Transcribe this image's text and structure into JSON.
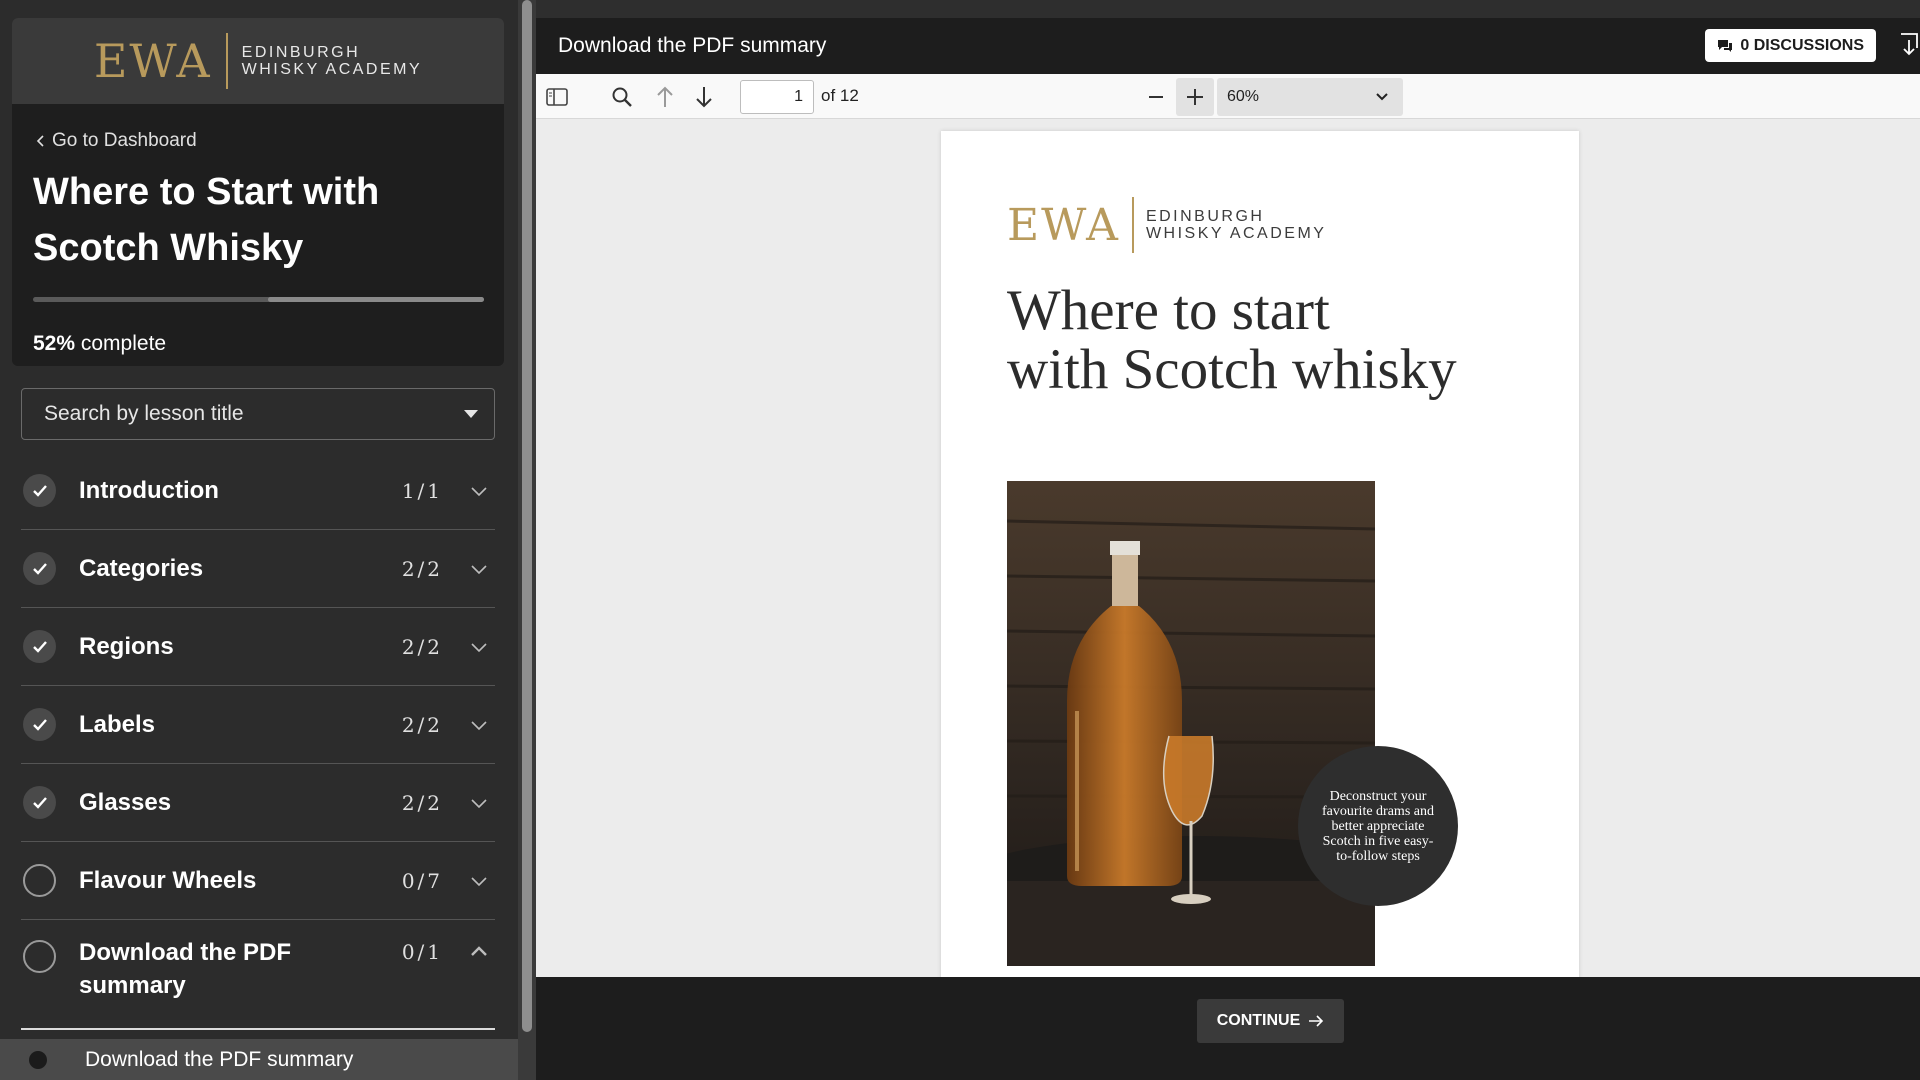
{
  "brand": {
    "mark": "EWA",
    "name_line1": "EDINBURGH",
    "name_line2": "WHISKY ACADEMY"
  },
  "sidebar": {
    "back_link": "Go to Dashboard",
    "course_title": "Where to Start with Scotch Whisky",
    "progress_percent": 52,
    "progress_value": "52%",
    "progress_label": "complete",
    "search_placeholder": "Search by lesson title",
    "lessons": [
      {
        "label": "Introduction",
        "count": "1/1",
        "done": true
      },
      {
        "label": "Categories",
        "count": "2/2",
        "done": true
      },
      {
        "label": "Regions",
        "count": "2/2",
        "done": true
      },
      {
        "label": "Labels",
        "count": "2/2",
        "done": true
      },
      {
        "label": "Glasses",
        "count": "2/2",
        "done": true
      },
      {
        "label": "Flavour Wheels",
        "count": "0/7",
        "done": false
      },
      {
        "label": "Download the PDF summary",
        "count": "0/1",
        "done": false,
        "expanded": true
      }
    ],
    "active_sub_lesson": "Download the PDF summary"
  },
  "main": {
    "header_title": "Download the PDF summary",
    "discussions_button": "0 DISCUSSIONS",
    "continue_button": "CONTINUE"
  },
  "pdf_viewer": {
    "page_number": "1",
    "page_of": "of 12",
    "zoom": "60%"
  },
  "pdf_page": {
    "headline_line1": "Where to start",
    "headline_line2": "with Scotch whisky",
    "badge_text": "Deconstruct your favourite drams and better appreciate Scotch in five easy-to-follow steps"
  },
  "colors": {
    "gold": "#b89a5c",
    "sidebar_bg": "#2c2c2c",
    "card_bg": "#1e1e1e",
    "viewer_bg": "#ececec"
  }
}
